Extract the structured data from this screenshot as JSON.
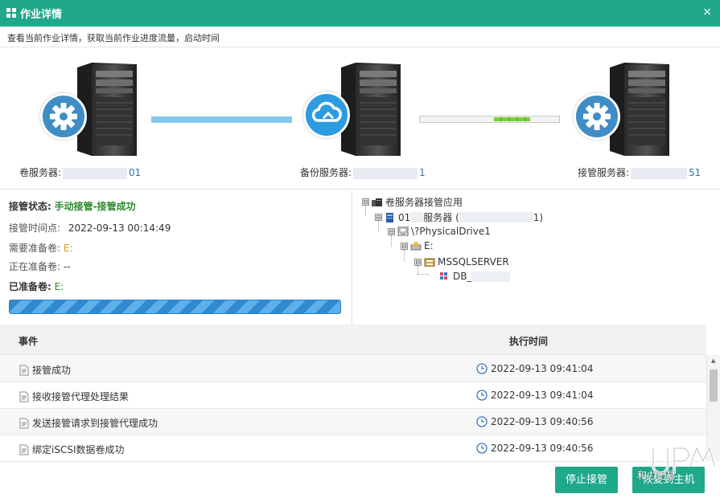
{
  "window": {
    "title": "作业详情",
    "subtitle": "查看当前作业详情，获取当前作业进度流量，启动时间",
    "close_glyph": "×"
  },
  "topology": {
    "volume_server": {
      "label": "卷服务器:",
      "suffix": "01",
      "badge_icon": "gear-icon"
    },
    "backup_server": {
      "label": "备份服务器:",
      "suffix": "1",
      "badge_icon": "cloud-icon"
    },
    "takeover_server": {
      "label": "接管服务器:",
      "suffix": "51",
      "badge_icon": "gear-icon"
    },
    "transfer_progress": 0.26,
    "link_color": "#86c8ec",
    "progress_color": "#7bd133"
  },
  "status": {
    "state_label": "接管状态:",
    "state_value": "手动接管-接管成功",
    "time_label": "接管时间点:",
    "time_value": "2022-09-13 00:14:49",
    "need_label": "需要准备卷:",
    "need_value": "E:",
    "preparing_label": "正在准备卷:",
    "preparing_value": "--",
    "ready_label": "已准备卷:",
    "ready_value": "E:",
    "volume_progress": 1.0
  },
  "tree": {
    "root": "卷服务器接管应用",
    "server": "01",
    "server_mid": "服务器 (",
    "server_tail": "1)",
    "drive": "\\?PhysicalDrive1",
    "volume": "E:",
    "instance": "MSSQLSERVER",
    "db": "DB_",
    "toggle": "⊟"
  },
  "events": {
    "headers": {
      "event": "事件",
      "time": "执行时间"
    },
    "rows": [
      {
        "event": "接管成功",
        "time": "2022-09-13 09:41:04"
      },
      {
        "event": "接收接管代理处理结果",
        "time": "2022-09-13 09:41:04"
      },
      {
        "event": "发送接管请求到接管代理成功",
        "time": "2022-09-13 09:40:56"
      },
      {
        "event": "绑定iSCSI数据卷成功",
        "time": "2022-09-13 09:40:56"
      }
    ]
  },
  "buttons": {
    "stop": "停止接管",
    "restore": "恢复到主机"
  },
  "watermark": {
    "text": "和力记易"
  },
  "colors": {
    "accent": "#1fa88a",
    "success": "#2c8a2c",
    "warning": "#e59a1a",
    "badge_blue": "#3f8dc4"
  }
}
